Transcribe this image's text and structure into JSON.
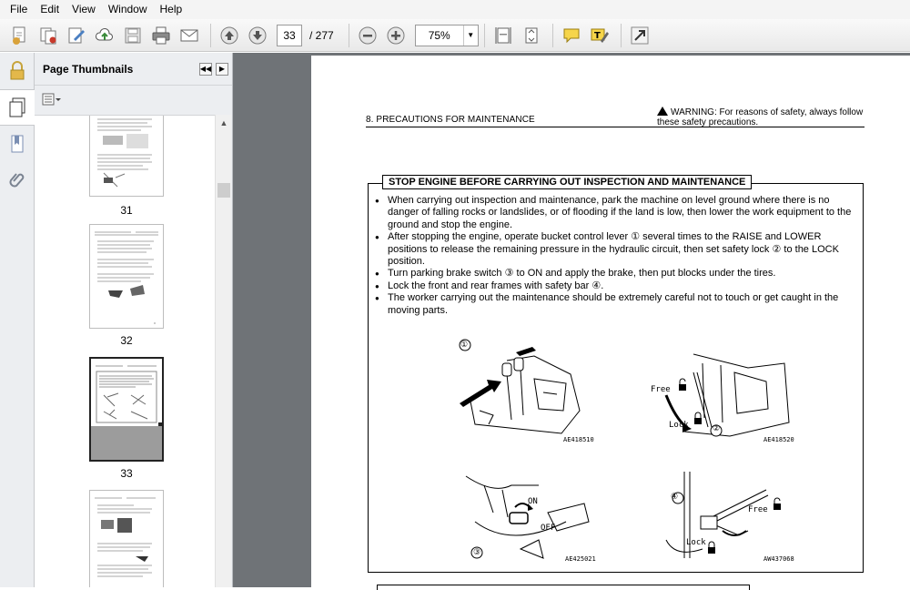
{
  "menu": [
    "File",
    "Edit",
    "View",
    "Window",
    "Help"
  ],
  "toolbar": {
    "current_page": "33",
    "total_pages": "/ 277",
    "zoom": "75%",
    "icons": [
      "create-pdf-icon",
      "combine-icon",
      "edit-icon",
      "upload-cloud-icon",
      "save-icon",
      "print-icon",
      "email-icon",
      "prev-page-icon",
      "next-page-icon",
      "zoom-out-icon",
      "zoom-in-icon",
      "fit-page-icon",
      "fit-width-icon",
      "comment-icon",
      "highlight-icon",
      "expand-icon"
    ]
  },
  "sidebar": {
    "title": "Page Thumbnails",
    "thumbnails": [
      {
        "label": "31",
        "selected": false
      },
      {
        "label": "32",
        "selected": false
      },
      {
        "label": "33",
        "selected": true
      },
      {
        "label": "",
        "selected": false
      }
    ]
  },
  "document": {
    "section_header": "8. PRECAUTIONS FOR MAINTENANCE",
    "warning": "WARNING: For reasons of safety, always follow these safety precautions.",
    "box_title": "STOP ENGINE BEFORE CARRYING OUT INSPECTION AND MAINTENANCE",
    "bullets": [
      "When carrying out inspection and maintenance, park the machine on level ground where there is no danger of falling rocks or landslides, or of flooding if the land is low, then lower the work equipment to the ground and stop the engine.",
      "After stopping the engine, operate bucket control lever ① several times to the RAISE and LOWER positions to release the remaining pressure in the hydraulic circuit, then set safety lock ② to the LOCK position.",
      "Turn parking brake switch ③ to ON and apply the brake, then put blocks under the tires.",
      "Lock the front and rear frames with safety bar ④.",
      "The worker carrying out the maintenance should be extremely careful not to touch or get caught in the moving parts."
    ],
    "figures": [
      {
        "caption": "AE418510",
        "marker": "①"
      },
      {
        "caption": "AE418520",
        "marker": "②",
        "free": "Free",
        "lock": "Lock"
      },
      {
        "caption": "AE425021",
        "marker": "③",
        "on": "ON",
        "off": "OFF"
      },
      {
        "caption": "AW437068",
        "marker": "④",
        "free": "Free",
        "lock": "Lock"
      }
    ]
  }
}
